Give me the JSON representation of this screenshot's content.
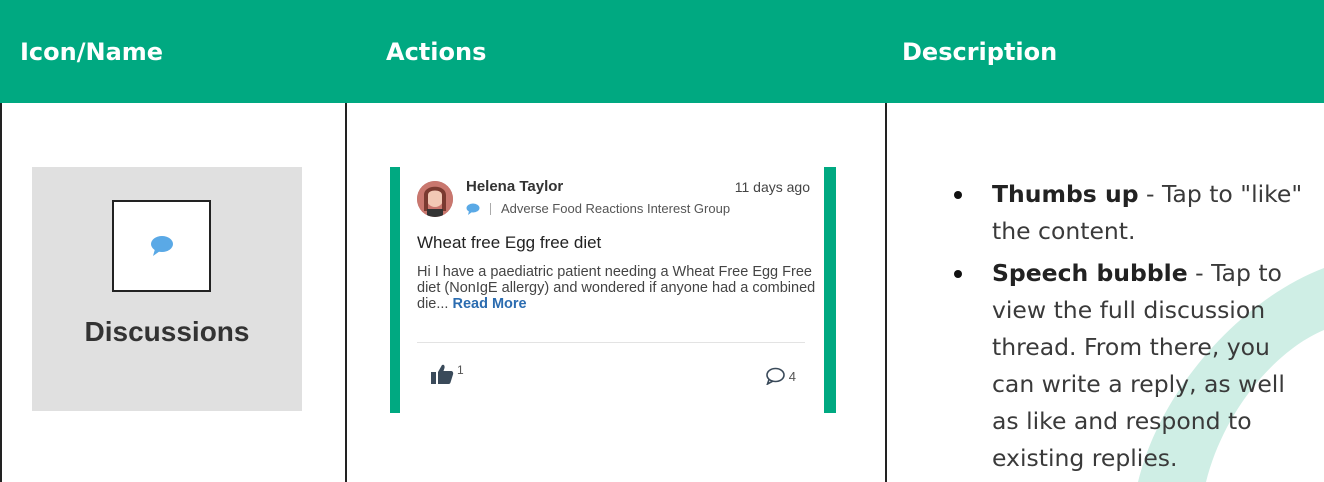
{
  "colors": {
    "header_bg": "#00a981",
    "header_text": "#ffffff",
    "accent": "#00a981",
    "link": "#2b6cb0",
    "tile_bg": "#e0e0e0",
    "bubble_blue": "#5aa9e6"
  },
  "table": {
    "headers": [
      "Icon/Name",
      "Actions",
      "Description"
    ]
  },
  "icon_tile": {
    "icon": "speech-bubble-icon",
    "label": "Discussions"
  },
  "post_card": {
    "author": "Helena Taylor",
    "time_ago": "11 days ago",
    "group_icon": "speech-bubble-icon",
    "group": "Adverse Food Reactions Interest Group",
    "title": "Wheat free Egg free diet",
    "body": "Hi I have a paediatric patient needing a Wheat Free Egg Free diet (NonIgE allergy) and wondered if anyone had a combined die...",
    "read_more": "Read More",
    "like_icon": "thumbs-up-icon",
    "like_count": "1",
    "comment_icon": "comment-bubble-icon",
    "comment_count": "4"
  },
  "description": {
    "items": [
      {
        "term": "Thumbs up",
        "text": " - Tap to \"like\" the content."
      },
      {
        "term": "Speech bubble",
        "text": " - Tap to view the full discussion thread. From there, you can write a reply, as well as like and respond to existing replies."
      }
    ]
  }
}
